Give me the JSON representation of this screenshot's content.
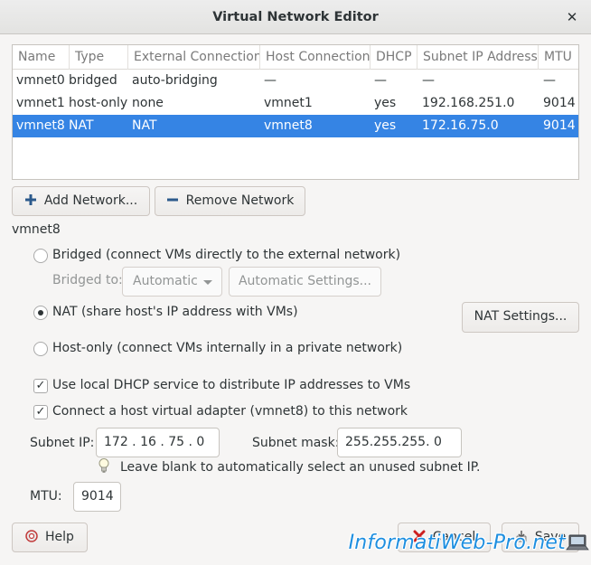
{
  "window": {
    "title": "Virtual Network Editor",
    "close_glyph": "✕"
  },
  "table": {
    "columns": [
      "Name",
      "Type",
      "External Connection",
      "Host Connection",
      "DHCP",
      "Subnet IP Address",
      "MTU"
    ],
    "rows": [
      [
        "vmnet0",
        "bridged",
        "auto-bridging",
        "—",
        "—",
        "—",
        "—"
      ],
      [
        "vmnet1",
        "host-only",
        "none",
        "vmnet1",
        "yes",
        "192.168.251.0",
        "9014"
      ],
      [
        "vmnet8",
        "NAT",
        "NAT",
        "vmnet8",
        "yes",
        "172.16.75.0",
        "9014"
      ]
    ],
    "selected_row_index": 2
  },
  "actions": {
    "add_network": "Add Network...",
    "remove_network": "Remove Network"
  },
  "details": {
    "network_name": "vmnet8",
    "bridged_option": "Bridged (connect VMs directly to the external network)",
    "bridged_to_label": "Bridged to:",
    "bridged_to_value": "Automatic",
    "automatic_settings": "Automatic Settings...",
    "nat_option": "NAT (share host's IP address with VMs)",
    "nat_settings": "NAT Settings...",
    "hostonly_option": "Host-only (connect VMs internally in a private network)",
    "selected_mode": "nat",
    "dhcp_label": "Use local DHCP service to distribute IP addresses to VMs",
    "dhcp_checked": true,
    "adapter_label": "Connect a host virtual adapter (vmnet8) to this network",
    "adapter_checked": true,
    "check_glyph": "✓",
    "subnet_ip_label": "Subnet IP:",
    "subnet_ip_value": "172 . 16 . 75 . 0",
    "subnet_mask_label": "Subnet mask:",
    "subnet_mask_value": "255.255.255. 0",
    "hint": "Leave blank to automatically select an unused subnet IP.",
    "mtu_label": "MTU:",
    "mtu_value": "9014"
  },
  "footer": {
    "help": "Help",
    "cancel": "Cancel",
    "save": "Save"
  },
  "watermark": "InformatiWeb-Pro.net",
  "colors": {
    "selection": "#3584e4",
    "text": "#2e3436",
    "muted": "#929595",
    "watermark": "#1e8fe0"
  }
}
